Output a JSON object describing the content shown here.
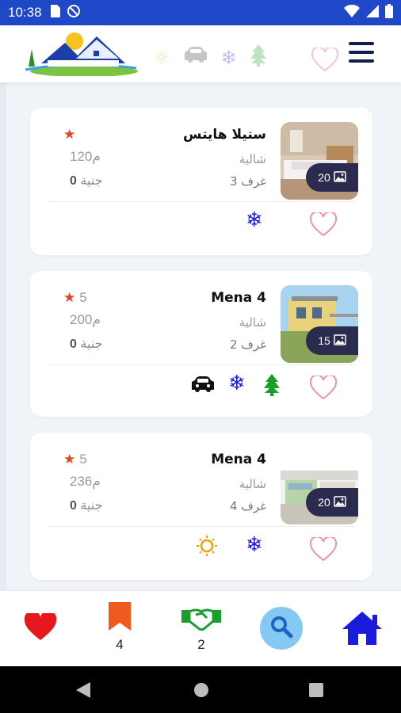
{
  "status_bar": {
    "time": "10:38",
    "icons": [
      "sd-card-icon",
      "no-sync-icon",
      "wifi-icon",
      "signal-icon",
      "battery-icon"
    ]
  },
  "header": {
    "logo": "house-logo",
    "filter_icons": [
      "sun-icon",
      "car-icon",
      "snowflake-icon",
      "tree-icon"
    ],
    "favorite_icon": "heart-outline-icon",
    "menu_icon": "hamburger-menu-icon"
  },
  "listings": [
    {
      "title": "ستيلا هايتس",
      "type": "شالية",
      "rooms": "3 غرف",
      "rating": "",
      "area": "120م",
      "price_value": "0",
      "price_unit": "جنية",
      "photo_count": "20",
      "features": [
        "snowflake-icon"
      ]
    },
    {
      "title": "Mena 4",
      "type": "شالية",
      "rooms": "2 غرف",
      "rating": "5",
      "area": "200م",
      "price_value": "0",
      "price_unit": "جنية",
      "photo_count": "15",
      "features": [
        "car-icon",
        "snowflake-icon",
        "tree-icon"
      ]
    },
    {
      "title": "Mena 4",
      "type": "شالية",
      "rooms": "4 غرف",
      "rating": "5",
      "area": "236م",
      "price_value": "0",
      "price_unit": "جنية",
      "photo_count": "20",
      "features": [
        "sun-icon",
        "snowflake-icon"
      ]
    }
  ],
  "bottom_nav": {
    "favorites_icon": "heart-icon",
    "bookmarks_count": "4",
    "deals_count": "2",
    "search_icon": "search-icon",
    "home_icon": "home-icon"
  },
  "colors": {
    "status_bar": "#1f48c9",
    "accent_blue": "#1b1bdc",
    "heart_red": "#e8171e",
    "bookmark_orange": "#f05a1e",
    "deal_green": "#1a9e2c",
    "search_bg": "#84c8f4",
    "favorite_pink": "#ee8fb8"
  }
}
